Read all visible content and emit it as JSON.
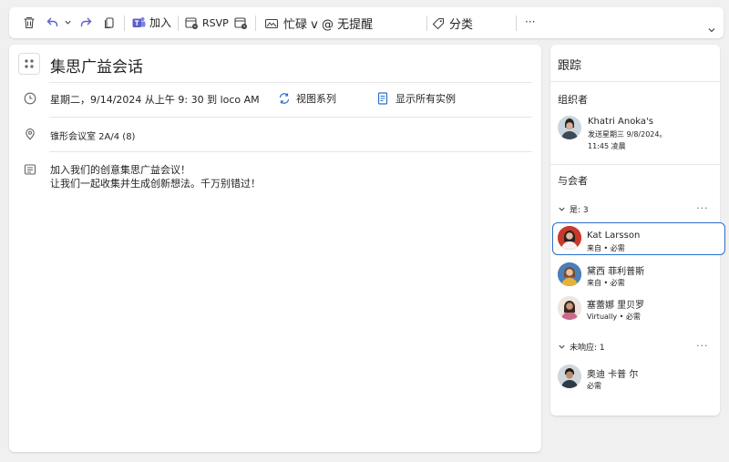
{
  "toolbar": {
    "join_label": "加入",
    "rsvp_label": "RSVP",
    "status_label": "忙碌 v @ 无提醒",
    "category_label": "分类",
    "more_label": "···"
  },
  "event": {
    "title": "集思广益会话",
    "datetime": "星期二，9/14/2024 从上午 9: 30 到 loco AM",
    "view_series": "视图系列",
    "show_all": "显示所有实例",
    "location": "锥形会议室 2A/4 (8)",
    "body_line1": "加入我们的创意集思广益会议！",
    "body_line2": "让我们一起收集并生成创新想法。千万别错过！"
  },
  "tracking": {
    "heading": "跟踪",
    "organizer_label": "组织者",
    "organizer_name": "Khatri Anoka's",
    "organizer_sent": "发送星期三 9/8/2024。",
    "organizer_time": "11:45 凌晨",
    "attendees_label": "与会者",
    "group_yes": "是: 3",
    "group_noresp": "未响应: 1",
    "attendees_yes": [
      {
        "name": "Kat Larsson",
        "detail": "来自 • 必需"
      },
      {
        "name": "黛西 菲利普斯",
        "detail": "来自 • 必需"
      },
      {
        "name": "塞蕾娜 里贝罗",
        "detail": "Virtually • 必需"
      }
    ],
    "attendees_noresp": [
      {
        "name": "奥迪 卡普 尔",
        "detail": "必需"
      }
    ]
  },
  "colors": {
    "accent": "#2a6fc9",
    "teams_purple": "#5b5fc7"
  }
}
